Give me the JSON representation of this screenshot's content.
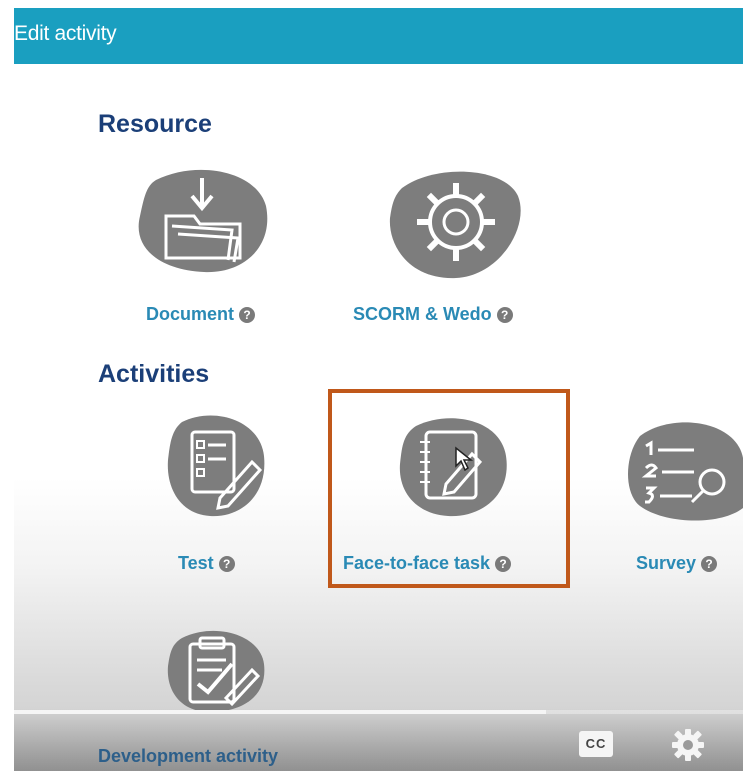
{
  "header": {
    "title": "Edit activity"
  },
  "sections": {
    "resource": {
      "title": "Resource",
      "items": [
        {
          "label": "Document",
          "icon": "folder-download-icon"
        },
        {
          "label": "SCORM & Wedo",
          "icon": "gear-package-icon"
        }
      ]
    },
    "activities": {
      "title": "Activities",
      "items": [
        {
          "label": "Test",
          "icon": "checklist-pencil-icon"
        },
        {
          "label": "Face-to-face task",
          "icon": "notebook-pen-icon",
          "selected": true
        },
        {
          "label": "Survey",
          "icon": "list-magnifier-icon"
        },
        {
          "label": "Development activity",
          "icon": "clipboard-check-icon"
        }
      ]
    }
  },
  "help_glyph": "?",
  "video_controls": {
    "cc_label": "CC",
    "progress": 0.73
  },
  "colors": {
    "header": "#1a9fc0",
    "section_title": "#1b3f78",
    "link": "#2a8ab5",
    "selection": "#c0581a",
    "icon": "#7d7d7d"
  }
}
